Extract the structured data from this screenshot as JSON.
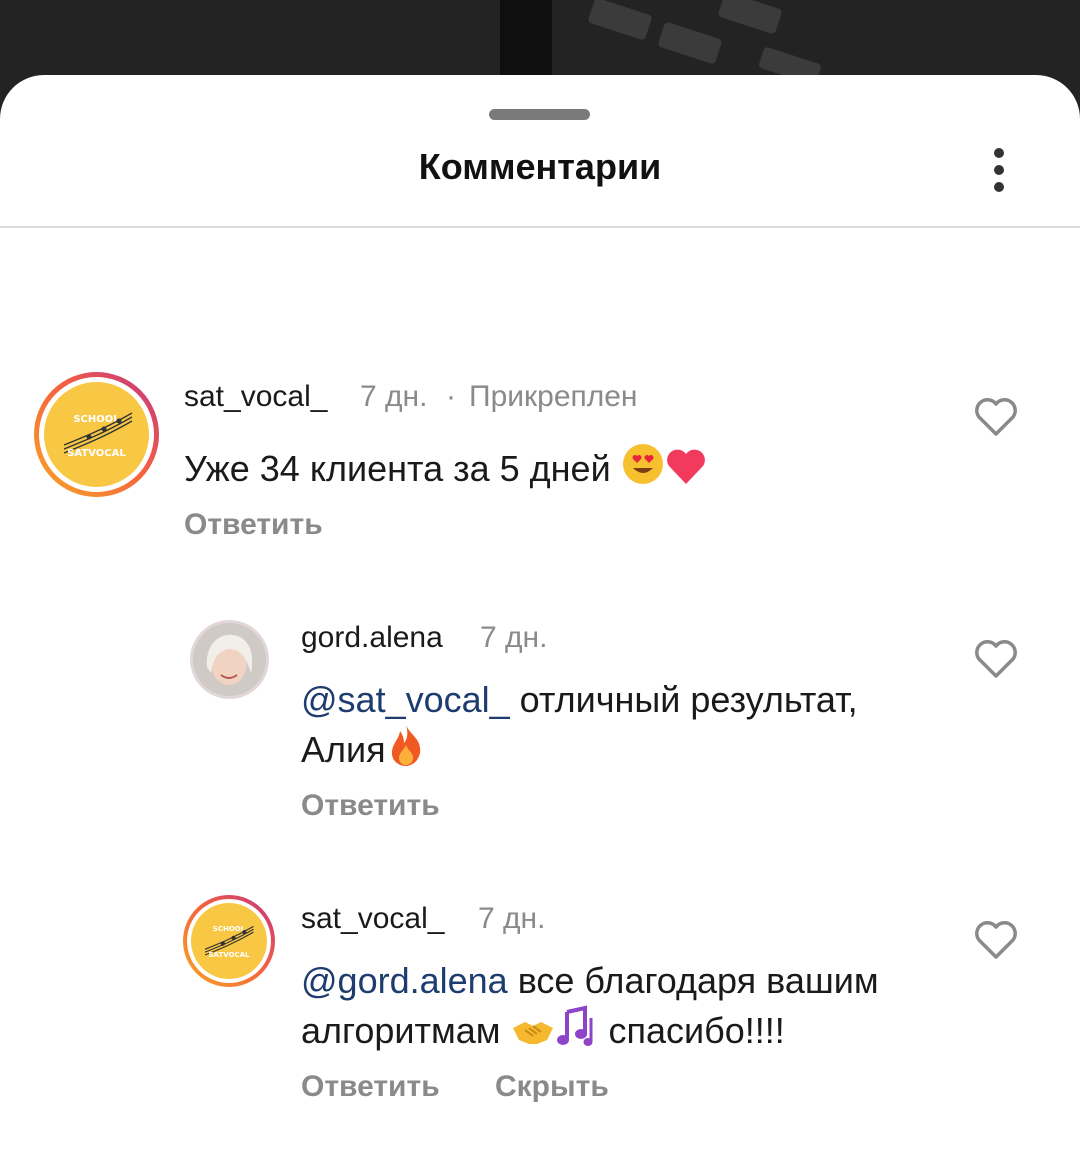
{
  "sheet": {
    "title": "Комментарии",
    "more_icon": "more-vertical-icon"
  },
  "comments": [
    {
      "username": "sat_vocal_",
      "age": "7 дн.",
      "separator": "·",
      "pinned": "Прикреплен",
      "text": "Уже 34 клиента за 5 дней",
      "emojis": [
        "heart-eyes-emoji",
        "heart-emoji"
      ],
      "reply": "Ответить",
      "avatar_text": [
        "SCHOOL",
        "SATVOCAL"
      ]
    },
    {
      "username": "gord.alena",
      "age": "7 дн.",
      "mention": "@sat_vocal_",
      "text_line1": " отличный результат,",
      "text_line2": "Алия",
      "emojis": [
        "fire-emoji"
      ],
      "reply": "Ответить"
    },
    {
      "username": "sat_vocal_",
      "age": "7 дн.",
      "mention": "@gord.alena",
      "text_line1": " все благодаря вашим",
      "text_line2a": "алгоритмам ",
      "text_line2b": " спасибо!!!!",
      "emojis": [
        "handshake-emoji",
        "musical-notes-emoji"
      ],
      "reply": "Ответить",
      "hide": "Скрыть",
      "avatar_text": [
        "SCHOOL",
        "SATVOCAL"
      ]
    }
  ],
  "colors": {
    "mention": "#1d3c6f",
    "meta": "#8a8a8a",
    "story_ring_start": "#f9a825",
    "story_ring_end": "#c13584"
  }
}
